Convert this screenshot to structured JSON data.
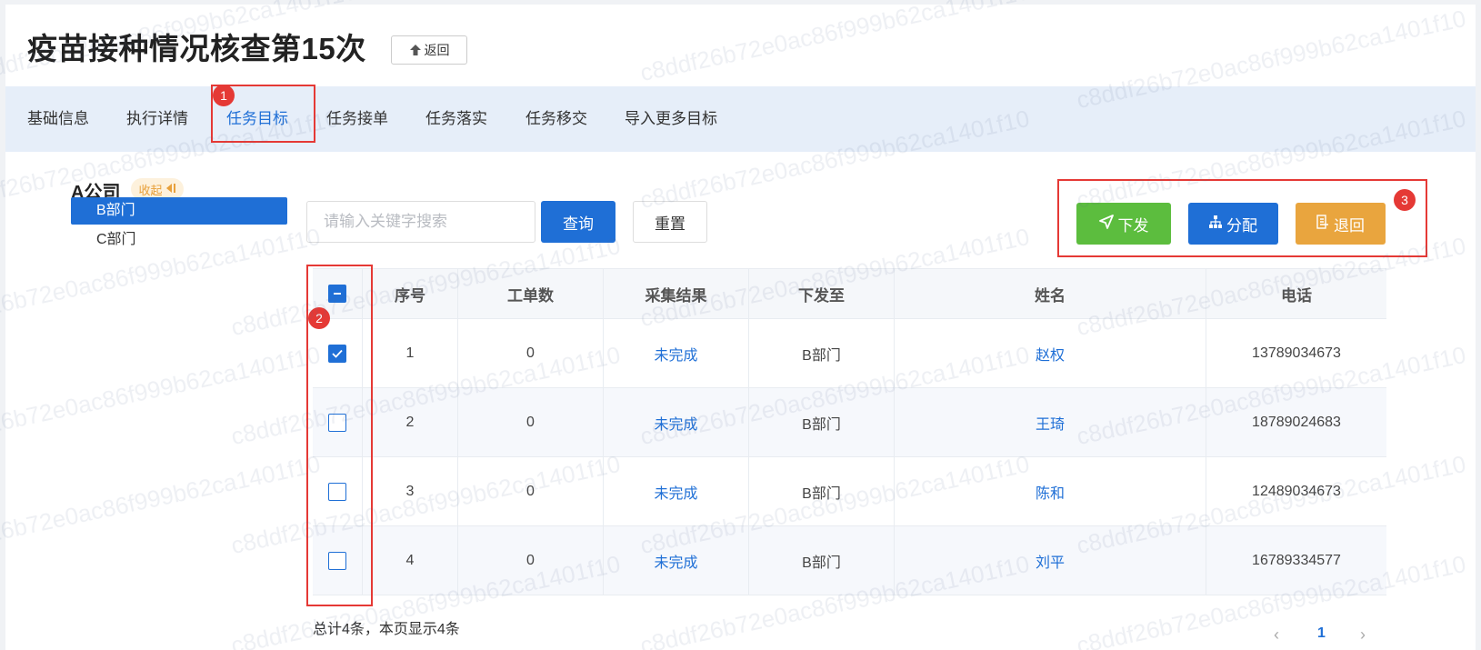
{
  "header": {
    "title": "疫苗接种情况核查第15次",
    "back_label": "返回"
  },
  "tabs": [
    {
      "label": "基础信息"
    },
    {
      "label": "执行详情"
    },
    {
      "label": "任务目标"
    },
    {
      "label": "任务接单"
    },
    {
      "label": "任务落实"
    },
    {
      "label": "任务移交"
    },
    {
      "label": "导入更多目标"
    }
  ],
  "markers": {
    "m1": "1",
    "m2": "2",
    "m3": "3"
  },
  "tree": {
    "root": "A公司",
    "collapse_label": "收起",
    "items": [
      {
        "label": "B部门"
      },
      {
        "label": "C部门"
      }
    ]
  },
  "search": {
    "placeholder": "请输入关键字搜索",
    "query_label": "查询",
    "reset_label": "重置"
  },
  "actions": {
    "issue_label": "下发",
    "assign_label": "分配",
    "return_label": "退回"
  },
  "table": {
    "columns": [
      "序号",
      "工单数",
      "采集结果",
      "下发至",
      "姓名",
      "电话"
    ],
    "rows": [
      {
        "checked": true,
        "no": "1",
        "orders": "0",
        "result": "未完成",
        "dept": "B部门",
        "name": "赵权",
        "phone": "13789034673"
      },
      {
        "checked": false,
        "no": "2",
        "orders": "0",
        "result": "未完成",
        "dept": "B部门",
        "name": "王琦",
        "phone": "18789024683"
      },
      {
        "checked": false,
        "no": "3",
        "orders": "0",
        "result": "未完成",
        "dept": "B部门",
        "name": "陈和",
        "phone": "12489034673"
      },
      {
        "checked": false,
        "no": "4",
        "orders": "0",
        "result": "未完成",
        "dept": "B部门",
        "name": "刘平",
        "phone": "16789334577"
      }
    ]
  },
  "footer": {
    "total": "总计4条，本页显示4条",
    "current_page": "1"
  },
  "watermark": "c8ddf26b72e0ac86f999b62ca1401f10",
  "colors": {
    "primary": "#1f6fd6",
    "issue": "#5cbd3e",
    "return": "#e9a53e",
    "highlight": "#e53935"
  }
}
